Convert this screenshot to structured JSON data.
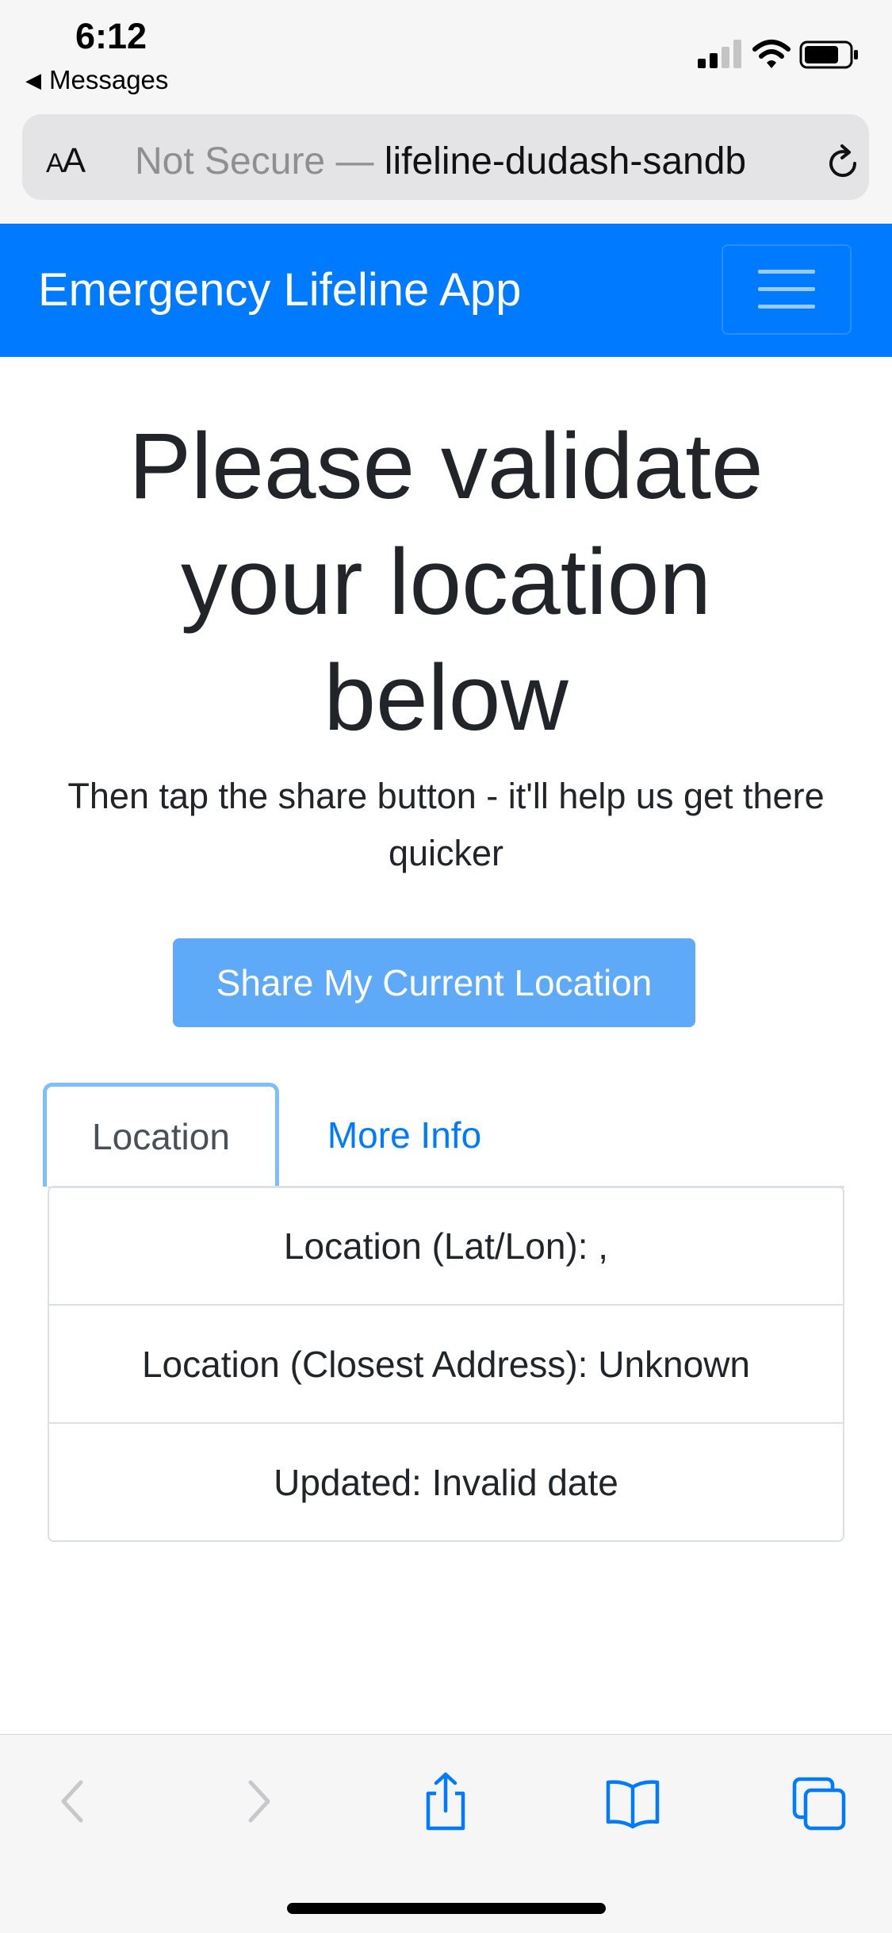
{
  "status_bar": {
    "time": "6:12",
    "back_app": "Messages",
    "back_icon": "back-triangle-icon"
  },
  "address_bar": {
    "aa_small": "A",
    "aa_large": "A",
    "security": "Not Secure —",
    "domain": "lifeline-dudash-sandb"
  },
  "navbar": {
    "brand": "Emergency Lifeline App",
    "bg_color": "#007bff"
  },
  "main": {
    "heading": "Please validate your location below",
    "subtext": "Then tap the share button - it'll help us get there quicker",
    "share_button": "Share My Current Location"
  },
  "tabs": [
    {
      "label": "Location",
      "active": true
    },
    {
      "label": "More Info",
      "active": false
    }
  ],
  "location_list": [
    "Location (Lat/Lon): ,",
    "Location (Closest Address): Unknown",
    "Updated: Invalid date"
  ],
  "toolbar": {
    "icons": [
      "back-icon",
      "forward-icon",
      "share-icon",
      "bookmarks-icon",
      "tabs-icon"
    ],
    "accent_color": "#007aff"
  }
}
